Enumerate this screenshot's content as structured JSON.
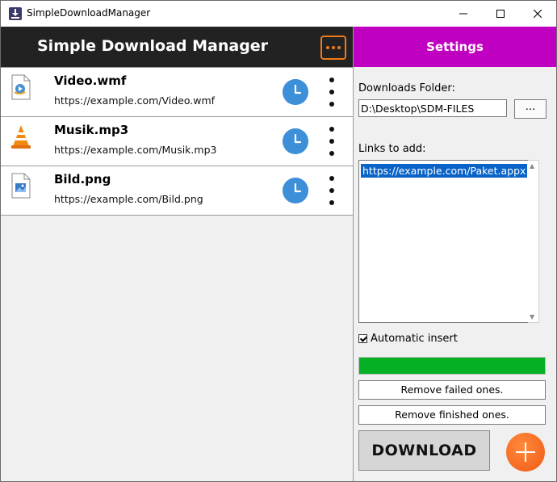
{
  "window": {
    "title": "SimpleDownloadManager"
  },
  "header": {
    "title": "Simple Download Manager"
  },
  "downloads": [
    {
      "name": "Video.wmf",
      "url": "https://example.com/Video.wmf",
      "icon": "media-file-icon"
    },
    {
      "name": "Musik.mp3",
      "url": "https://example.com/Musik.mp3",
      "icon": "vlc-cone-icon"
    },
    {
      "name": "Bild.png",
      "url": "https://example.com/Bild.png",
      "icon": "image-file-icon"
    }
  ],
  "settings": {
    "title": "Settings",
    "folder_label": "Downloads Folder:",
    "folder_value": "D:\\Desktop\\SDM-FILES",
    "browse_label": "...",
    "links_label": "Links to add:",
    "links_value": "https://example.com/Paket.appx",
    "auto_insert_label": "Automatic insert",
    "auto_insert_checked": true,
    "progress_fraction": 1.0,
    "remove_failed_label": "Remove failed ones.",
    "remove_finished_label": "Remove finished ones.",
    "download_label": "DOWNLOAD"
  },
  "colors": {
    "header_bg": "#222222",
    "settings_bg": "#c000c0",
    "accent_orange": "#f07a1a",
    "clock_blue": "#3d8fd8",
    "progress_green": "#06b025"
  }
}
